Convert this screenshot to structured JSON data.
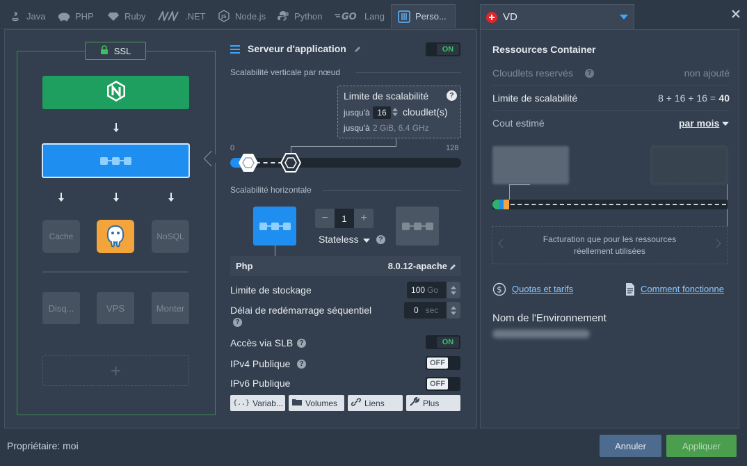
{
  "tabs": [
    {
      "label": "Java",
      "icon": "java-icon",
      "active": false
    },
    {
      "label": "PHP",
      "icon": "php-icon",
      "active": false
    },
    {
      "label": "Ruby",
      "icon": "ruby-icon",
      "active": false
    },
    {
      "label": ".NET",
      "icon": "dotnet-icon",
      "active": false
    },
    {
      "label": "Node.js",
      "icon": "nodejs-icon",
      "active": false
    },
    {
      "label": "Python",
      "icon": "python-icon",
      "active": false
    },
    {
      "label": "Lang",
      "icon": "go-icon",
      "active": false
    },
    {
      "label": "Perso...",
      "icon": "custom-icon",
      "active": true
    }
  ],
  "region": {
    "label": "VD",
    "icon": "swiss-flag-icon"
  },
  "topology": {
    "ssl_label": "SSL",
    "nodes": {
      "cache": "Cache",
      "nosql": "NoSQL",
      "disk": "Disq...",
      "vps": "VPS",
      "build": "Monter"
    },
    "add_symbol": "+"
  },
  "config": {
    "title": "Serveur d'application",
    "main_toggle": "ON",
    "vertical_label": "Scalabilité verticale par nœud",
    "tooltip": {
      "title": "Limite de scalabilité",
      "up_to": "jusqu'à",
      "cloudlets_value": "16",
      "cloudlets_unit": "cloudlet(s)",
      "resources_prefix": "jusqu'à",
      "resources": "2 GiB, 6.4 GHz"
    },
    "slider": {
      "min": "0",
      "max": "128",
      "reserved": 0,
      "limit": 16
    },
    "horizontal_label": "Scalabilité horizontale",
    "stepper": {
      "minus": "−",
      "value": "1",
      "plus": "+"
    },
    "stateless": "Stateless",
    "php_label": "Php",
    "php_version": "8.0.12-apache",
    "storage_label": "Limite de stockage",
    "storage_value": "100",
    "storage_unit": "Go",
    "restart_label": "Délai de redémarrage séquentiel",
    "restart_value": "0",
    "restart_unit": "sec",
    "slb_label": "Accès via SLB",
    "slb_toggle": "ON",
    "ipv4_label": "IPv4 Publique",
    "ipv4_toggle": "OFF",
    "ipv6_label": "IPv6 Publique",
    "ipv6_toggle": "OFF",
    "buttons": {
      "variables": "Variab...",
      "volumes": "Volumes",
      "links": "Liens",
      "more": "Plus"
    }
  },
  "resources": {
    "title": "Ressources Container",
    "reserved_label": "Cloudlets reservés",
    "reserved_value": "non ajouté",
    "limit_label": "Limite de scalabilité",
    "limit_formula": "8 + 16 + 16 =",
    "limit_total": "40",
    "cost_label": "Cout estimé",
    "period": "par mois",
    "billing_note": "Facturation que pour les ressources réellement utilisées",
    "quotas_link": "Quotas et tarifs",
    "how_link": "Comment fonctionne",
    "env_label": "Nom de l'Environnement"
  },
  "footer": {
    "owner": "Propriétaire: moi",
    "cancel": "Annuler",
    "apply": "Appliquer"
  },
  "colors": {
    "accent_blue": "#1e8ff0",
    "nginx_green": "#1f9f5f",
    "postgres_orange": "#f3a43a",
    "apply_green": "#4a9e4e",
    "cancel_blue": "#4d6a8f"
  }
}
